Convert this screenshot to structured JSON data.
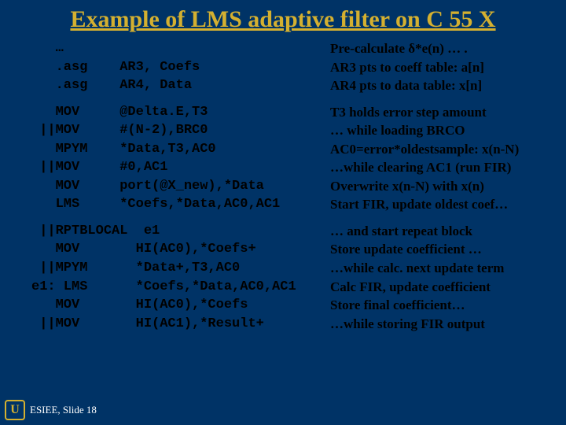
{
  "title": "Example of LMS adaptive filter on C 55 X",
  "block1": {
    "code": [
      "   …",
      "   .asg    AR3, Coefs",
      "   .asg    AR4, Data"
    ],
    "notes": [
      "Pre-calculate δ*e(n) … .",
      "AR3 pts to coeff table: a[n]",
      "AR4 pts to data table: x[n]"
    ]
  },
  "block2": {
    "code": [
      "   MOV     @Delta.E,T3",
      " ||MOV     #(N-2),BRC0",
      "   MPYM    *Data,T3,AC0",
      " ||MOV     #0,AC1",
      "   MOV     port(@X_new),*Data",
      "   LMS     *Coefs,*Data,AC0,AC1"
    ],
    "notes": [
      "T3 holds error step amount",
      "… while loading BRCO",
      "AC0=error*oldestsample: x(n-N)",
      "…while clearing AC1 (run FIR)",
      "Overwrite x(n-N) with x(n)",
      "Start FIR, update oldest coef…"
    ]
  },
  "block3": {
    "code": [
      " ||RPTBLOCAL  e1",
      "   MOV       HI(AC0),*Coefs+",
      " ||MPYM      *Data+,T3,AC0",
      "e1: LMS      *Coefs,*Data,AC0,AC1",
      "   MOV       HI(AC0),*Coefs",
      " ||MOV       HI(AC1),*Result+"
    ],
    "notes": [
      "… and start repeat block",
      "Store update coefficient  …",
      "…while calc. next update term",
      "Calc FIR, update coefficient",
      "Store final coefficient…",
      "…while storing FIR output"
    ]
  },
  "footer": {
    "logo": "U",
    "slide": "ESIEE, Slide 18"
  }
}
